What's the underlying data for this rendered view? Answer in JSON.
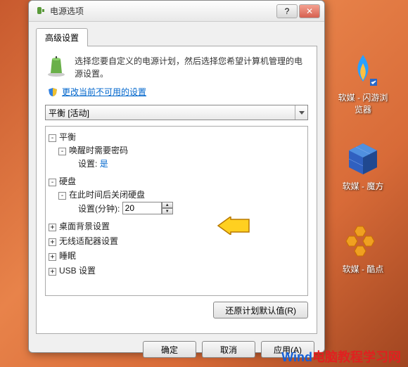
{
  "window": {
    "title": "电源选项"
  },
  "tab": {
    "label": "高级设置"
  },
  "intro": "选择您要自定义的电源计划，然后选择您希望计算机管理的电源设置。",
  "link": "更改当前不可用的设置",
  "plan": {
    "selected": "平衡 [活动]"
  },
  "tree": {
    "balance": "平衡",
    "wake_pw": "唤醒时需要密码",
    "wake_setting_label": "设置:",
    "wake_setting_value": "是",
    "disk": "硬盘",
    "disk_off": "在此时间后关闭硬盘",
    "disk_setting_label": "设置(分钟):",
    "disk_setting_value": "20",
    "desktop_bg": "桌面背景设置",
    "wireless": "无线适配器设置",
    "sleep": "睡眠",
    "usb": "USB 设置"
  },
  "restore_btn": "还原计划默认值(R)",
  "buttons": {
    "ok": "确定",
    "cancel": "取消",
    "apply": "应用(A)"
  },
  "desktop": {
    "icon1": "软媒 - 闪游浏览器",
    "icon2": "软媒 - 魔方",
    "icon3": "软媒 - 酷点"
  },
  "watermark": {
    "a": "Wind",
    "b": "电脑教程学习网"
  }
}
